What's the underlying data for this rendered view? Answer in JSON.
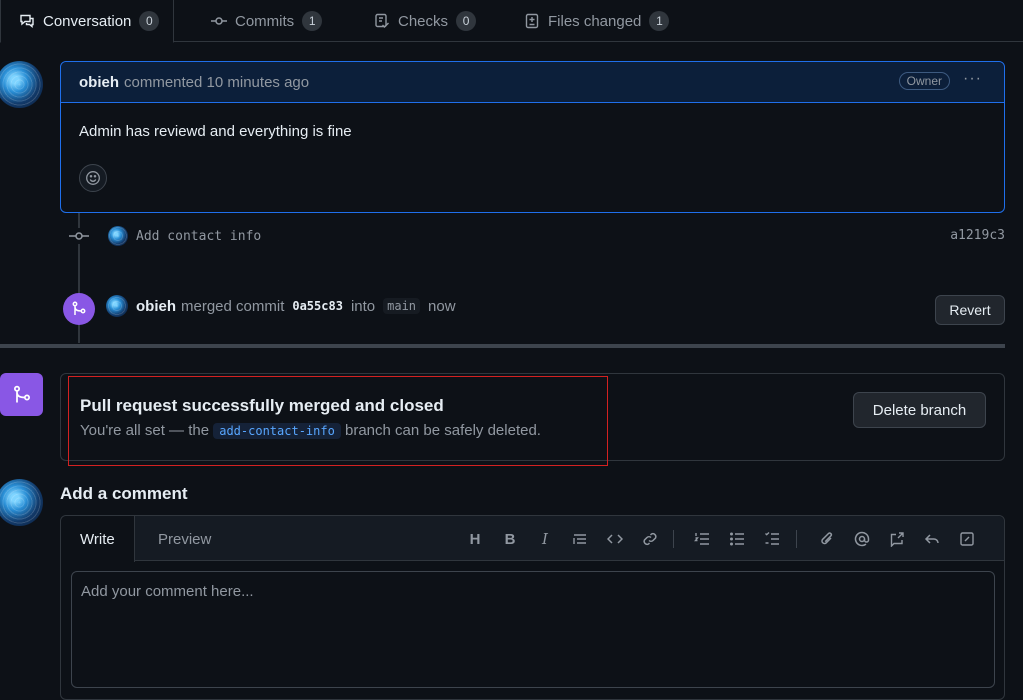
{
  "tabs": [
    {
      "label": "Conversation",
      "count": "0",
      "icon": "conversation-icon"
    },
    {
      "label": "Commits",
      "count": "1",
      "icon": "commit-icon"
    },
    {
      "label": "Checks",
      "count": "0",
      "icon": "checklist-icon"
    },
    {
      "label": "Files changed",
      "count": "1",
      "icon": "file-diff-icon"
    }
  ],
  "comment": {
    "author": "obieh",
    "action": "commented 10 minutes ago",
    "role_badge": "Owner",
    "menu": "···",
    "body": "Admin has reviewd and everything is fine"
  },
  "commit_event": {
    "message": "Add contact info",
    "sha": "a1219c3"
  },
  "merge_event": {
    "author": "obieh",
    "text_merged": "merged commit",
    "commit": "0a55c83",
    "text_into": "into",
    "branch": "main",
    "time": "now",
    "revert_label": "Revert"
  },
  "merged_box": {
    "title": "Pull request successfully merged and closed",
    "sub_prefix": "You're all set — the",
    "branch": "add-contact-info",
    "sub_suffix": "branch can be safely deleted.",
    "delete_label": "Delete branch"
  },
  "add_comment": {
    "title": "Add a comment",
    "write_tab": "Write",
    "preview_tab": "Preview",
    "placeholder": "Add your comment here..."
  },
  "colors": {
    "accent": "#1f6feb",
    "merged_purple": "#8957e5",
    "highlight_red": "#d32121"
  }
}
